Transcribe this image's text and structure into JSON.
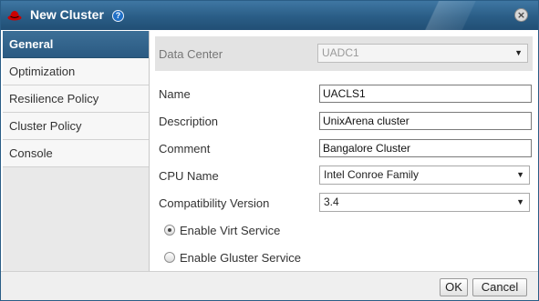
{
  "window": {
    "title": "New Cluster",
    "help_icon": "help-icon",
    "close_icon": "close-icon",
    "logo_icon": "redhat-logo-icon",
    "accent_color": "#2a5d86"
  },
  "sidebar": {
    "items": [
      {
        "label": "General",
        "active": true
      },
      {
        "label": "Optimization",
        "active": false
      },
      {
        "label": "Resilience Policy",
        "active": false
      },
      {
        "label": "Cluster Policy",
        "active": false
      },
      {
        "label": "Console",
        "active": false
      }
    ]
  },
  "form": {
    "data_center": {
      "label": "Data Center",
      "value": "UADC1"
    },
    "name": {
      "label": "Name",
      "value": "UACLS1"
    },
    "description": {
      "label": "Description",
      "value": "UnixArena cluster"
    },
    "comment": {
      "label": "Comment",
      "value": "Bangalore Cluster"
    },
    "cpu_name": {
      "label": "CPU Name",
      "value": "Intel Conroe Family"
    },
    "compat_version": {
      "label": "Compatibility Version",
      "value": "3.4"
    },
    "virt_service": {
      "label": "Enable Virt Service",
      "checked": true
    },
    "gluster_service": {
      "label": "Enable Gluster Service",
      "checked": false
    }
  },
  "footer": {
    "ok_label": "OK",
    "cancel_label": "Cancel"
  }
}
